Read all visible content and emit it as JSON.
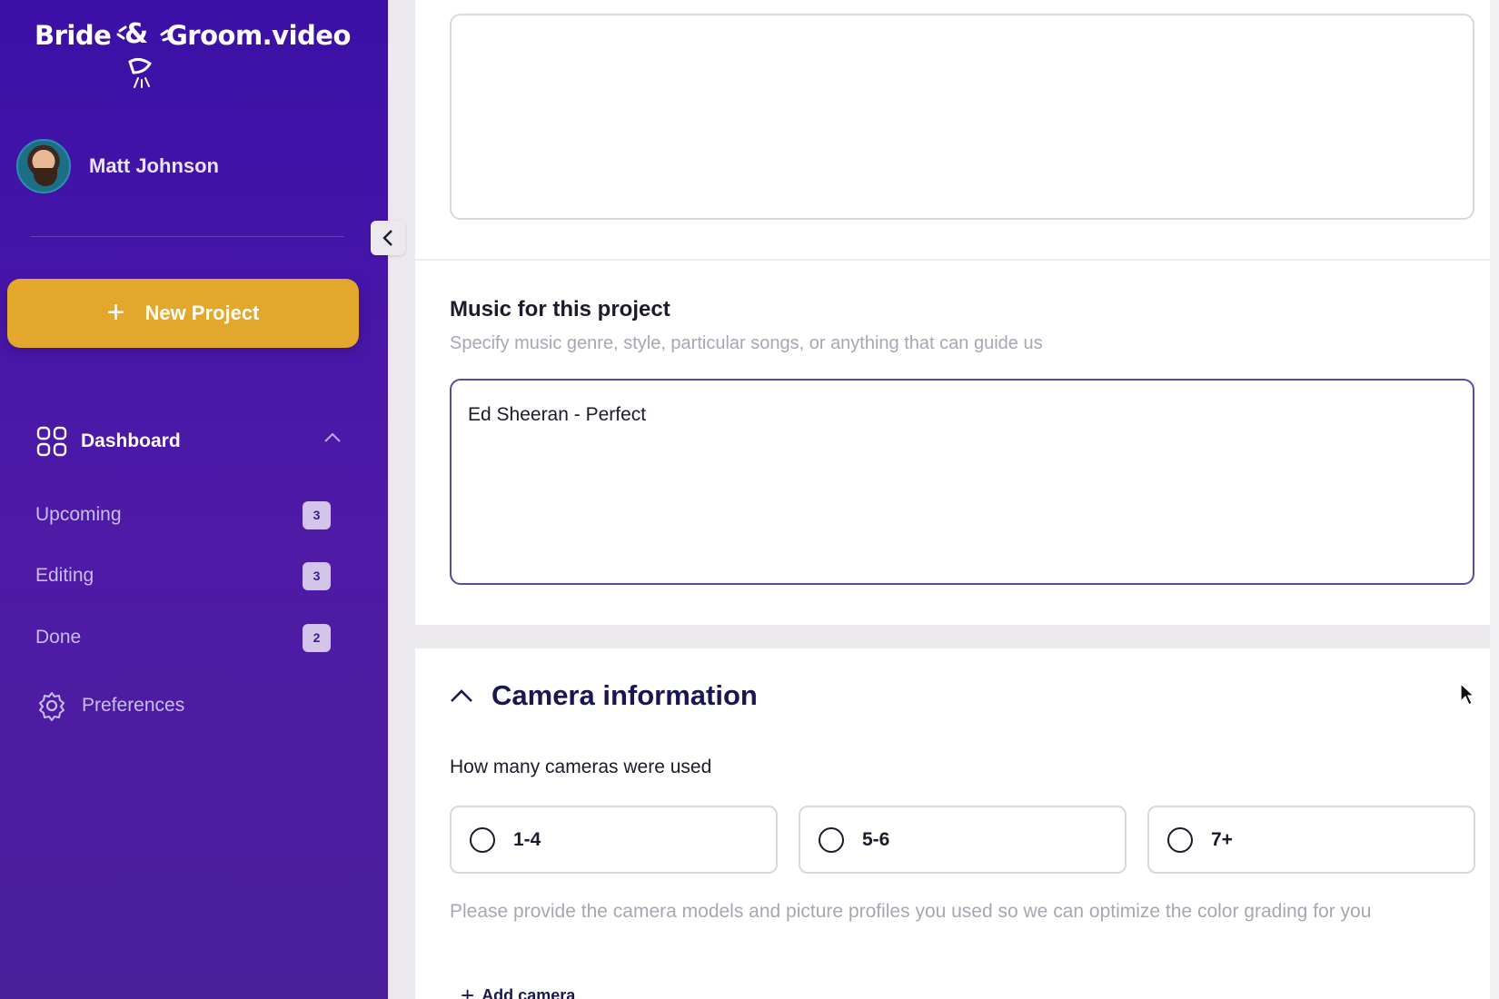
{
  "brand": {
    "left": "Bride",
    "amp": "&",
    "right": "Groom.video"
  },
  "user": {
    "name": "Matt Johnson"
  },
  "sidebar": {
    "new_project_label": "New Project",
    "dashboard_label": "Dashboard",
    "items": [
      {
        "label": "Upcoming",
        "count": "3"
      },
      {
        "label": "Editing",
        "count": "3"
      },
      {
        "label": "Done",
        "count": "2"
      }
    ],
    "preferences_label": "Preferences"
  },
  "main": {
    "top_textarea_value": "",
    "music": {
      "title": "Music for this project",
      "subtitle": "Specify music genre, style, particular songs, or anything that can guide us",
      "value": "Ed Sheeran - Perfect"
    },
    "camera": {
      "title": "Camera information",
      "question": "How many cameras were used",
      "options": [
        "1-4",
        "5-6",
        "7+"
      ],
      "help": "Please provide the camera models and picture profiles you used so we can optimize the color grading for you",
      "add_label": "Add camera"
    }
  },
  "colors": {
    "sidebar_top": "#3b10a6",
    "sidebar_bottom": "#4a1f9c",
    "accent": "#e3a82b",
    "heading": "#1a1650"
  }
}
